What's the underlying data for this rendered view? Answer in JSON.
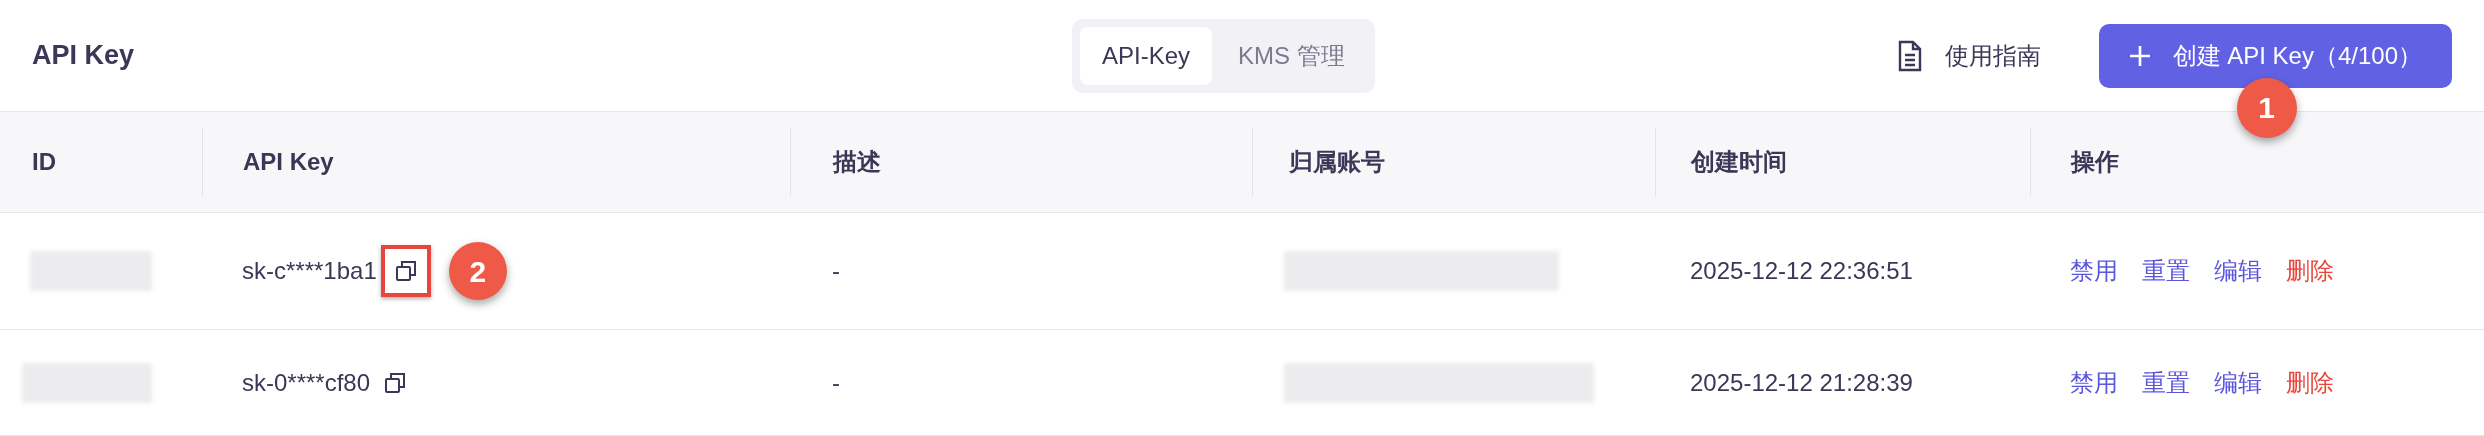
{
  "page_title": "API Key",
  "tabs": [
    {
      "label": "API-Key",
      "selected": true
    },
    {
      "label": "KMS 管理",
      "selected": false
    }
  ],
  "guide_link": {
    "label": "使用指南"
  },
  "create_button": {
    "label": "创建 API Key（4/100）",
    "badge": "1"
  },
  "table": {
    "columns": [
      "ID",
      "API Key",
      "描述",
      "归属账号",
      "创建时间",
      "操作"
    ],
    "rows": [
      {
        "id_redacted": true,
        "api_key": "sk-c****1ba1",
        "copy_highlighted": true,
        "badge": "2",
        "description": "-",
        "account_redacted": true,
        "created": "2025-12-12 22:36:51",
        "actions": [
          {
            "label": "禁用",
            "kind": "normal"
          },
          {
            "label": "重置",
            "kind": "normal"
          },
          {
            "label": "编辑",
            "kind": "normal"
          },
          {
            "label": "删除",
            "kind": "danger"
          }
        ]
      },
      {
        "id_redacted": true,
        "api_key": "sk-0****cf80",
        "copy_highlighted": false,
        "description": "-",
        "account_redacted": true,
        "created": "2025-12-12 21:28:39",
        "actions": [
          {
            "label": "禁用",
            "kind": "normal"
          },
          {
            "label": "重置",
            "kind": "normal"
          },
          {
            "label": "编辑",
            "kind": "normal"
          },
          {
            "label": "删除",
            "kind": "danger"
          }
        ]
      }
    ]
  }
}
